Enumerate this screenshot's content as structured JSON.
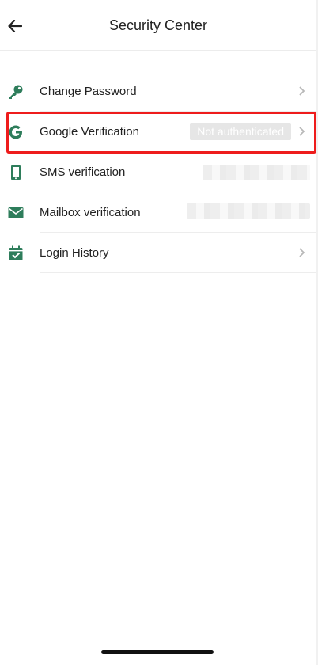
{
  "header": {
    "title": "Security Center",
    "back_icon": "arrow-left-icon"
  },
  "accent_color": "#2e7d5b",
  "items": [
    {
      "label": "Change Password",
      "icon": "key-icon",
      "chevron": true
    },
    {
      "label": "Google Verification",
      "icon": "google-g-icon",
      "status": "Not authenticated",
      "chevron": true,
      "highlighted": true
    },
    {
      "label": "SMS verification",
      "icon": "phone-icon",
      "value_obscured": true
    },
    {
      "label": "Mailbox verification",
      "icon": "mail-icon",
      "value_obscured": true
    },
    {
      "label": "Login History",
      "icon": "calendar-check-icon",
      "chevron": true
    }
  ]
}
